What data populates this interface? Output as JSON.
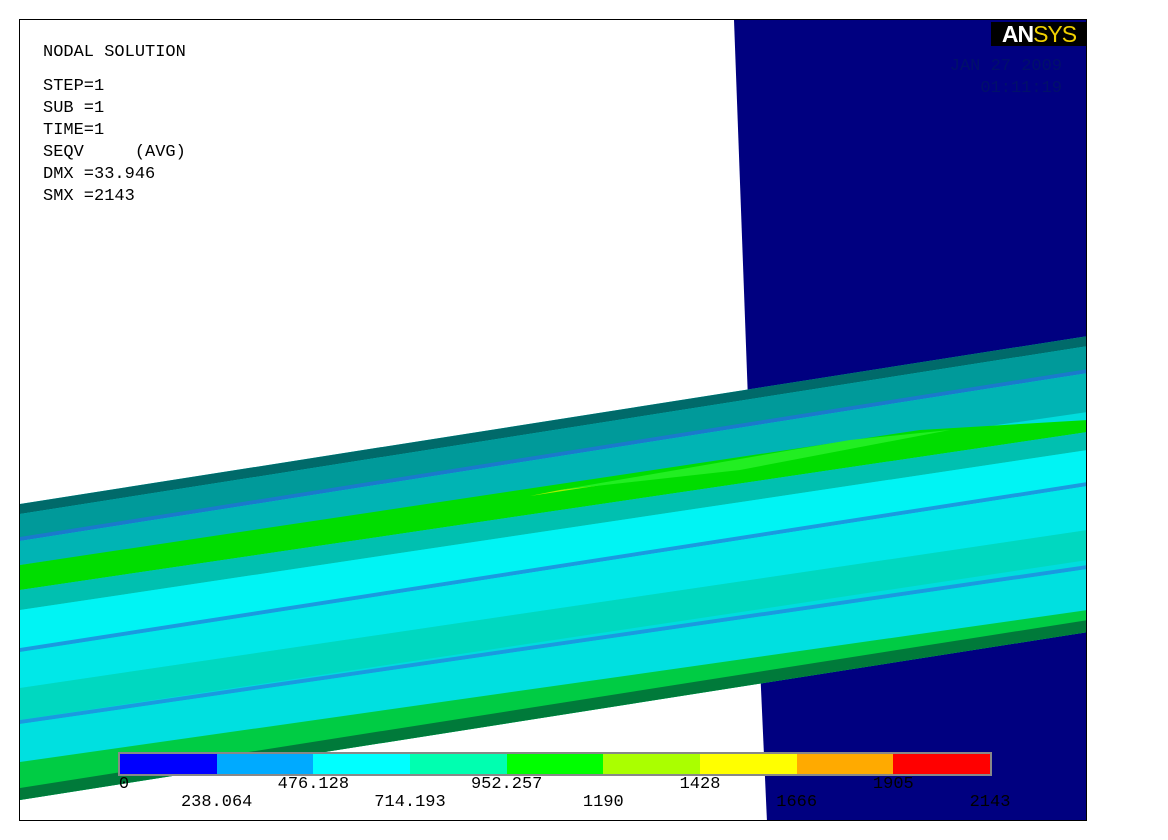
{
  "info": {
    "title": "NODAL SOLUTION",
    "step": "STEP=1",
    "sub": "SUB =1",
    "time": "TIME=1",
    "seqv": "SEQV     (AVG)",
    "dmx": "DMX =33.946",
    "smx": "SMX =2143"
  },
  "stamp": {
    "date": "JAN 27 2009",
    "time": "01:11:19"
  },
  "logo": {
    "an": "AN",
    "sys": "SYS"
  },
  "legend": {
    "colors": [
      "#0000ff",
      "#00aaff",
      "#00ffff",
      "#00ffb0",
      "#00ff00",
      "#aaff00",
      "#ffff00",
      "#ffaa00",
      "#ff0000"
    ],
    "labels_top": [
      "0",
      "476.128",
      "952.257",
      "1428",
      "1905"
    ],
    "labels_bottom": [
      "238.064",
      "714.193",
      "1190",
      "1666",
      "2143"
    ]
  },
  "scene_colors": {
    "plate": "#000080",
    "cyan": "#00eeee",
    "light_cyan": "#00ffff",
    "teal": "#00c8c8",
    "dark_teal": "#008888",
    "green": "#00ee00",
    "yellow_green": "#aaee00",
    "blue_line": "#1a9ae0",
    "orange": "#ee9900"
  }
}
